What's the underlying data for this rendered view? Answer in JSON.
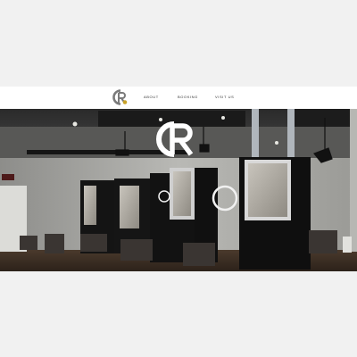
{
  "brand": {
    "logo_letters": "CR",
    "accent_color": "#c9a227",
    "logo_color": "#ffffff"
  },
  "nav": {
    "items": [
      {
        "label": "ABOUT"
      },
      {
        "label": "BOOKING"
      },
      {
        "label": "VISIT US"
      }
    ]
  },
  "hero": {
    "image_description_icon": "salon-interior-photo"
  },
  "colors": {
    "page_background": "#f1f1f1",
    "navbar_background": "#ffffff",
    "nav_text": "#333333"
  }
}
